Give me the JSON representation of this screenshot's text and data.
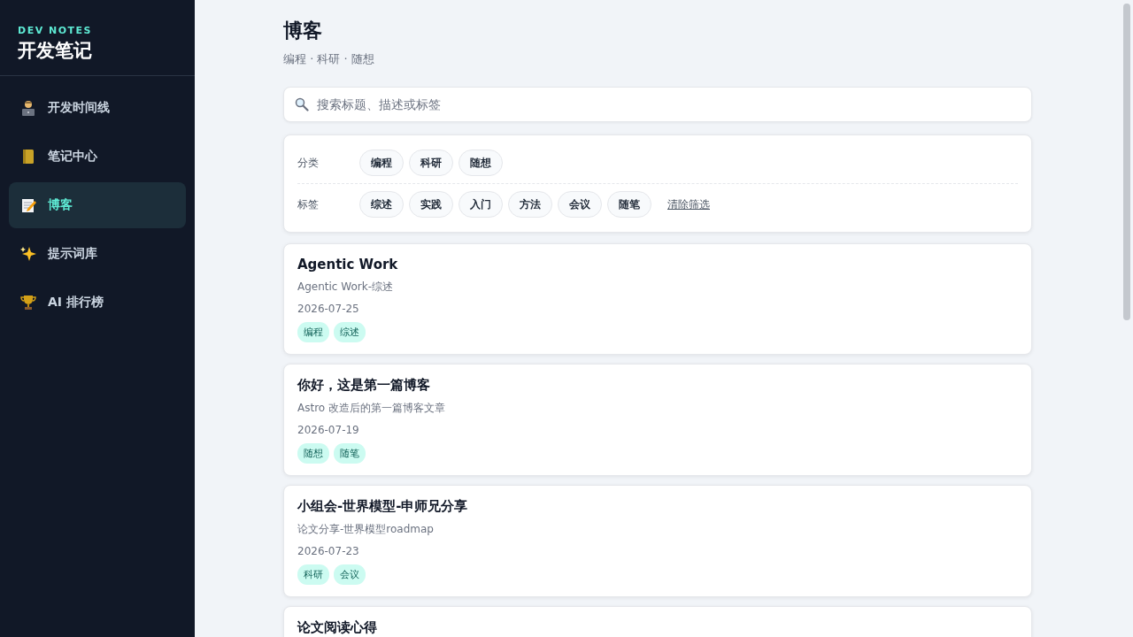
{
  "sidebar": {
    "brand_kicker": "DEV NOTES",
    "brand_title": "开发笔记",
    "items": [
      {
        "label": "开发时间线",
        "selected": false
      },
      {
        "label": "笔记中心",
        "selected": false
      },
      {
        "label": "博客",
        "selected": true
      },
      {
        "label": "提示词库",
        "selected": false
      },
      {
        "label": "AI 排行榜",
        "selected": false
      }
    ]
  },
  "header": {
    "title": "博客",
    "subtitle": "编程 · 科研 · 随想"
  },
  "search": {
    "placeholder": "搜索标题、描述或标签"
  },
  "filters": {
    "category_label": "分类",
    "categories": [
      {
        "label": "编程",
        "selected": false
      },
      {
        "label": "科研",
        "selected": false
      },
      {
        "label": "随想",
        "selected": false
      }
    ],
    "tag_label": "标签",
    "tags": [
      {
        "label": "综述",
        "selected": false
      },
      {
        "label": "实践",
        "selected": false
      },
      {
        "label": "入门",
        "selected": false
      },
      {
        "label": "方法",
        "selected": false
      },
      {
        "label": "会议",
        "selected": false
      },
      {
        "label": "随笔",
        "selected": false
      }
    ],
    "clear": "清除筛选"
  },
  "posts": [
    {
      "title": "Agentic Work",
      "description": "Agentic Work-综述",
      "date": "2026-07-25",
      "tags": [
        "编程",
        "综述"
      ]
    },
    {
      "title": "你好，这是第一篇博客",
      "description": "Astro 改造后的第一篇博客文章",
      "date": "2026-07-19",
      "tags": [
        "随想",
        "随笔"
      ]
    },
    {
      "title": "小组会-世界模型-申师兄分享",
      "description": "论文分享-世界模型roadmap",
      "date": "2026-07-23",
      "tags": [
        "科研",
        "会议"
      ]
    },
    {
      "title": "论文阅读心得"
    }
  ]
}
